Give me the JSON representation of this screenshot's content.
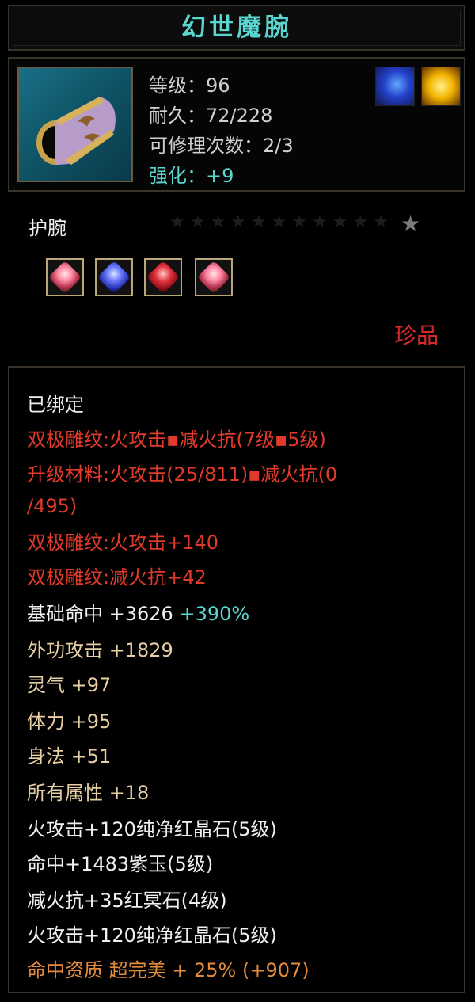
{
  "title": "幻世魔腕",
  "info": {
    "level": "等级：96",
    "durability": "耐久：72/228",
    "repairs": "可修理次数：2/3",
    "enhance": "强化：+9"
  },
  "icons": {
    "item": "bracer-icon",
    "side_left": "blue-rune-icon",
    "side_right": "gold-dragon-icon"
  },
  "type_label": "护腕",
  "quality": "珍品",
  "gems": [
    "pink-gem-icon",
    "sapphire-gem-icon",
    "ruby-gem-icon",
    "pink-gem-icon"
  ],
  "attributes": {
    "bound": "已绑定",
    "engrave1": "双极雕纹:火攻击▪减火抗(7级▪5级)",
    "upgrade1": "升级材料:火攻击(25/811)▪减火抗(0",
    "upgrade2": "/495)",
    "engrave2": "双极雕纹:火攻击+140",
    "engrave3": "双极雕纹:减火抗+42",
    "hit_base": "基础命中   +3626",
    "hit_pct": "+390%",
    "ext_attack": "外功攻击   +1829",
    "spirit": "灵气   +97",
    "stamina": "体力   +95",
    "agility": "身法   +51",
    "all_attr": "所有属性   +18",
    "gem1": "火攻击+120纯净红晶石(5级)",
    "gem2": "命中+1483紫玉(5级)",
    "gem3": "减火抗+35红冥石(4级)",
    "gem4": "火攻击+120纯净红晶石(5级)",
    "aptitude": "命中资质  超完美  + 25%  (+907)"
  }
}
